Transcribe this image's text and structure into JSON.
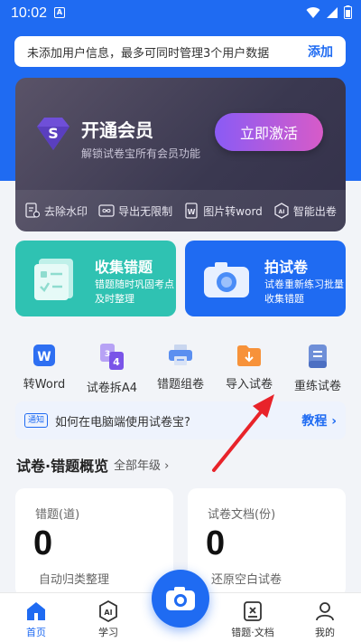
{
  "status_bar": {
    "time": "10:02",
    "a_badge": "A"
  },
  "notice": {
    "text": "未添加用户信息，最多可同时管理3个用户数据",
    "action": "添加"
  },
  "member": {
    "icon_letter": "S",
    "title": "开通会员",
    "subtitle": "解锁试卷宝所有会员功能",
    "activate_label": "立即激活",
    "perks": [
      {
        "label": "去除水印",
        "icon": "watermark-icon"
      },
      {
        "label": "导出无限制",
        "icon": "infinity-icon"
      },
      {
        "label": "图片转word",
        "icon": "word-doc-icon"
      },
      {
        "label": "智能出卷",
        "icon": "ai-icon"
      }
    ]
  },
  "tiles": [
    {
      "title": "收集错题",
      "subtitle": "错题随时巩固考点及时整理",
      "color": "#2fc2b2",
      "icon": "collect-mistakes-icon"
    },
    {
      "title": "拍试卷",
      "subtitle": "试卷重新练习批量收集错题",
      "color": "#1f6bf2",
      "icon": "camera-icon"
    }
  ],
  "quick_actions": [
    {
      "label": "转Word",
      "icon": "word-icon"
    },
    {
      "label": "试卷拆A4",
      "icon": "split-a4-icon",
      "badges": [
        "3",
        "4"
      ]
    },
    {
      "label": "错题组卷",
      "icon": "printer-icon"
    },
    {
      "label": "导入试卷",
      "icon": "folder-import-icon"
    },
    {
      "label": "重练试卷",
      "icon": "redo-paper-icon"
    }
  ],
  "tip": {
    "tag": "通知",
    "text": "如何在电脑端使用试卷宝?",
    "link": "教程 ›"
  },
  "overview": {
    "title": "试卷·错题概览",
    "grade_filter": "全部年级 ›",
    "cards": [
      {
        "label": "错题(道)",
        "value": "0",
        "desc": "自动归类整理"
      },
      {
        "label": "试卷文档(份)",
        "value": "0",
        "desc": "还原空白试卷"
      }
    ]
  },
  "bottom_nav": [
    {
      "label": "首页",
      "icon": "home-icon",
      "active": true
    },
    {
      "label": "学习",
      "icon": "ai-study-icon",
      "icon_text": "AI"
    },
    {
      "label": "错题·文档",
      "icon": "mistake-doc-icon"
    },
    {
      "label": "我的",
      "icon": "profile-icon"
    }
  ],
  "colors": {
    "brand": "#1f6bf2",
    "teal": "#2fc2b2",
    "arrow": "#e8232a"
  }
}
